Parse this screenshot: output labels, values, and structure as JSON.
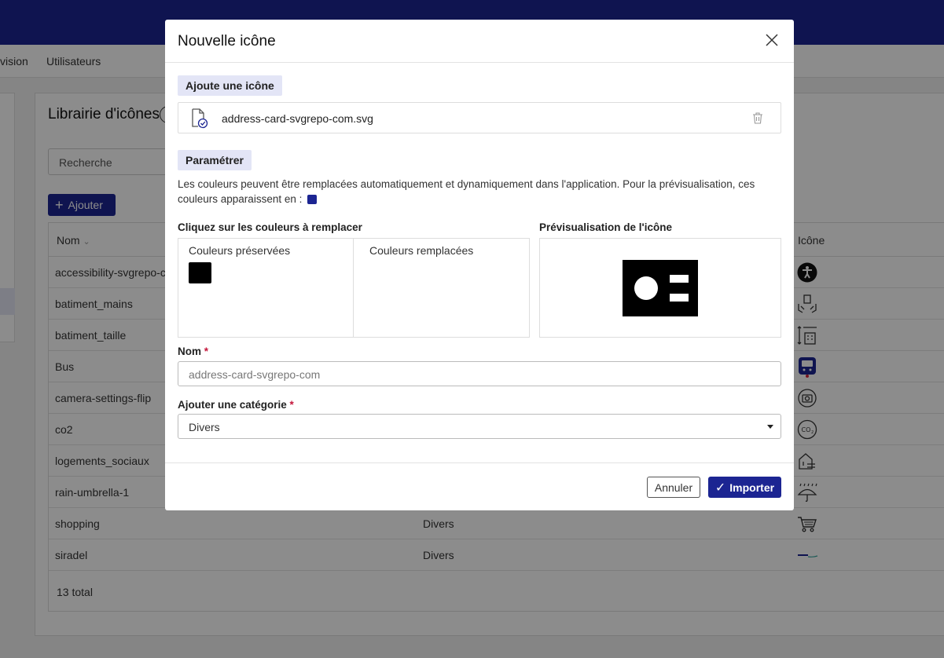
{
  "nav": {
    "items": [
      "vision",
      "Utilisateurs"
    ]
  },
  "library": {
    "title": "Librairie d'icônes",
    "search_placeholder": "Recherche",
    "add_label": "Ajouter",
    "columns": {
      "name": "Nom",
      "icon": "Icône"
    },
    "rows": [
      {
        "name": "accessibility-svgrepo-com",
        "category": "",
        "icon": "accessibility-icon"
      },
      {
        "name": "batiment_mains",
        "category": "",
        "icon": "building-hands-icon"
      },
      {
        "name": "batiment_taille",
        "category": "",
        "icon": "building-size-icon"
      },
      {
        "name": "Bus",
        "category": "",
        "icon": "bus-icon"
      },
      {
        "name": "camera-settings-flip",
        "category": "",
        "icon": "camera-flip-icon"
      },
      {
        "name": "co2",
        "category": "",
        "icon": "co2-icon"
      },
      {
        "name": "logements_sociaux",
        "category": "",
        "icon": "social-housing-icon"
      },
      {
        "name": "rain-umbrella-1",
        "category": "",
        "icon": "rain-umbrella-icon"
      },
      {
        "name": "shopping",
        "category": "Divers",
        "icon": "shopping-cart-icon"
      },
      {
        "name": "siradel",
        "category": "Divers",
        "icon": "siradel-logo-icon"
      }
    ],
    "total": "13 total"
  },
  "modal": {
    "title": "Nouvelle icône",
    "add_section": "Ajoute une icône",
    "file_name": "address-card-svgrepo-com.svg",
    "settings_section": "Paramétrer",
    "description": "Les couleurs peuvent être remplacées automatiquement et dynamiquement dans l'application. Pour la prévisualisation, ces couleurs apparaissent en :",
    "replace_label": "Cliquez sur les couleurs à remplacer",
    "preserved_label": "Couleurs préservées",
    "replaced_label": "Couleurs remplacées",
    "preview_label": "Prévisualisation de l'icône",
    "name_label": "Nom",
    "name_placeholder": "address-card-svgrepo-com",
    "category_label": "Ajouter une catégorie",
    "category_value": "Divers",
    "required_mark": "*",
    "cancel_label": "Annuler",
    "import_label": "Importer"
  },
  "colors": {
    "accent": "#1c2592",
    "preview_replace": "#1c2592",
    "preserved": "#000000",
    "required": "#c4163b"
  }
}
